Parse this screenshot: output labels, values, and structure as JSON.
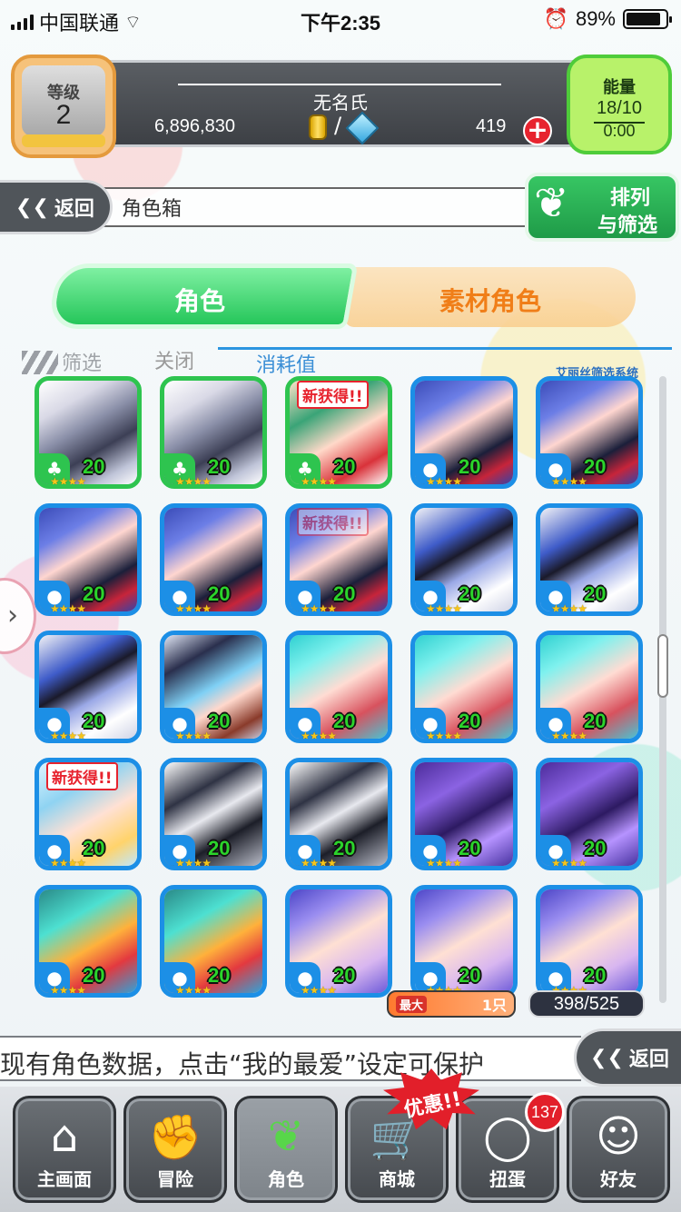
{
  "status_bar": {
    "carrier": "中国联通",
    "time": "下午2:35",
    "battery": "89%",
    "battery_level": 0.89
  },
  "header": {
    "level_label": "等级",
    "level_value": "2",
    "player_name": "无名氏",
    "gold": "6,896,830",
    "currency_separator": "/",
    "gems": "419",
    "energy_label": "能量",
    "energy_value": "18/10",
    "energy_timer": "0:00"
  },
  "title_bar": {
    "back_label": "返回",
    "page_title": "角色箱",
    "sort_line1": "排列",
    "sort_line2": "与筛选"
  },
  "tabs": [
    {
      "label": "角色",
      "active": true
    },
    {
      "label": "素材角色",
      "active": false
    }
  ],
  "filter": {
    "label": "筛选",
    "toggle": "关闭",
    "sort_by": "消耗值",
    "system_label": "艾丽丝筛选系统"
  },
  "cards": [
    {
      "portrait": "knight",
      "frame": "green",
      "element": "grass",
      "level": "20",
      "stars": "★★★★",
      "new": ""
    },
    {
      "portrait": "knight",
      "frame": "green",
      "element": "grass",
      "level": "20",
      "stars": "★★★★",
      "new": ""
    },
    {
      "portrait": "green",
      "frame": "green",
      "element": "grass",
      "level": "20",
      "stars": "★★★★",
      "new": "新获得!!"
    },
    {
      "portrait": "blue",
      "frame": "blue",
      "element": "water",
      "level": "20",
      "stars": "★★★★",
      "new": ""
    },
    {
      "portrait": "blue",
      "frame": "blue",
      "element": "water",
      "level": "20",
      "stars": "★★★★",
      "new": ""
    },
    {
      "portrait": "blue",
      "frame": "blue",
      "element": "water",
      "level": "20",
      "stars": "★★★★",
      "new": ""
    },
    {
      "portrait": "blue",
      "frame": "blue",
      "element": "water",
      "level": "20",
      "stars": "★★★★",
      "new": ""
    },
    {
      "portrait": "blue",
      "frame": "blue",
      "element": "water",
      "level": "20",
      "stars": "★★★★",
      "new": "新获得!!",
      "new_faded": true
    },
    {
      "portrait": "helm",
      "frame": "blue",
      "element": "water",
      "level": "20",
      "stars": "★★★★",
      "new": ""
    },
    {
      "portrait": "helm",
      "frame": "blue",
      "element": "water",
      "level": "20",
      "stars": "★★★★",
      "new": ""
    },
    {
      "portrait": "helm",
      "frame": "blue",
      "element": "water",
      "level": "20",
      "stars": "★★★★",
      "new": ""
    },
    {
      "portrait": "cap",
      "frame": "blue",
      "element": "water",
      "level": "20",
      "stars": "★★★★",
      "new": ""
    },
    {
      "portrait": "teal",
      "frame": "blue",
      "element": "water",
      "level": "20",
      "stars": "★★★★",
      "new": ""
    },
    {
      "portrait": "teal",
      "frame": "blue",
      "element": "water",
      "level": "20",
      "stars": "★★★★",
      "new": ""
    },
    {
      "portrait": "teal",
      "frame": "blue",
      "element": "water",
      "level": "20",
      "stars": "★★★★",
      "new": ""
    },
    {
      "portrait": "fairy",
      "frame": "blue",
      "element": "water",
      "level": "20",
      "stars": "★★★★",
      "new": "新获得!!"
    },
    {
      "portrait": "robot",
      "frame": "blue",
      "element": "water",
      "level": "20",
      "stars": "★★★★",
      "new": ""
    },
    {
      "portrait": "robot",
      "frame": "blue",
      "element": "water",
      "level": "20",
      "stars": "★★★★",
      "new": ""
    },
    {
      "portrait": "dragon",
      "frame": "blue",
      "element": "water",
      "level": "20",
      "stars": "★★★★",
      "new": ""
    },
    {
      "portrait": "dragon",
      "frame": "blue",
      "element": "water",
      "level": "20",
      "stars": "★★★★",
      "new": ""
    },
    {
      "portrait": "slime",
      "frame": "blue",
      "element": "water",
      "level": "20",
      "stars": "★★★★",
      "new": ""
    },
    {
      "portrait": "slime",
      "frame": "blue",
      "element": "water",
      "level": "20",
      "stars": "★★★★",
      "new": ""
    },
    {
      "portrait": "purple",
      "frame": "blue",
      "element": "water",
      "level": "20",
      "stars": "★★★★",
      "new": ""
    },
    {
      "portrait": "purple",
      "frame": "blue",
      "element": "water",
      "level": "20",
      "stars": "★★★★",
      "new": ""
    },
    {
      "portrait": "purple",
      "frame": "blue",
      "element": "water",
      "level": "20",
      "stars": "★★★★",
      "new": ""
    }
  ],
  "box_info": {
    "max_label": "最大",
    "max_value": "1只",
    "count": "398/525"
  },
  "ticker": {
    "text": "现有角色数据，点击“我的最爱”设定可保护",
    "back_label": "返回"
  },
  "nav": {
    "items": [
      {
        "label": "主画面",
        "icon": "home-icon",
        "glyph": "⌂"
      },
      {
        "label": "冒险",
        "icon": "handshake-icon",
        "glyph": "✊"
      },
      {
        "label": "角色",
        "icon": "bunny-icon",
        "glyph": "❦"
      },
      {
        "label": "商城",
        "icon": "cart-icon",
        "glyph": "🛒"
      },
      {
        "label": "扭蛋",
        "icon": "egg-icon",
        "glyph": "◯"
      },
      {
        "label": "好友",
        "icon": "friends-icon",
        "glyph": "☺"
      }
    ],
    "sale_badge": "优惠!!",
    "gacha_count": "137"
  },
  "colors": {
    "water_frame": "#1c8fe6",
    "grass_frame": "#2ec44f",
    "level_text": "#2bd42b",
    "active_tab": "#25c65a",
    "inactive_tab_text": "#f07e18"
  }
}
